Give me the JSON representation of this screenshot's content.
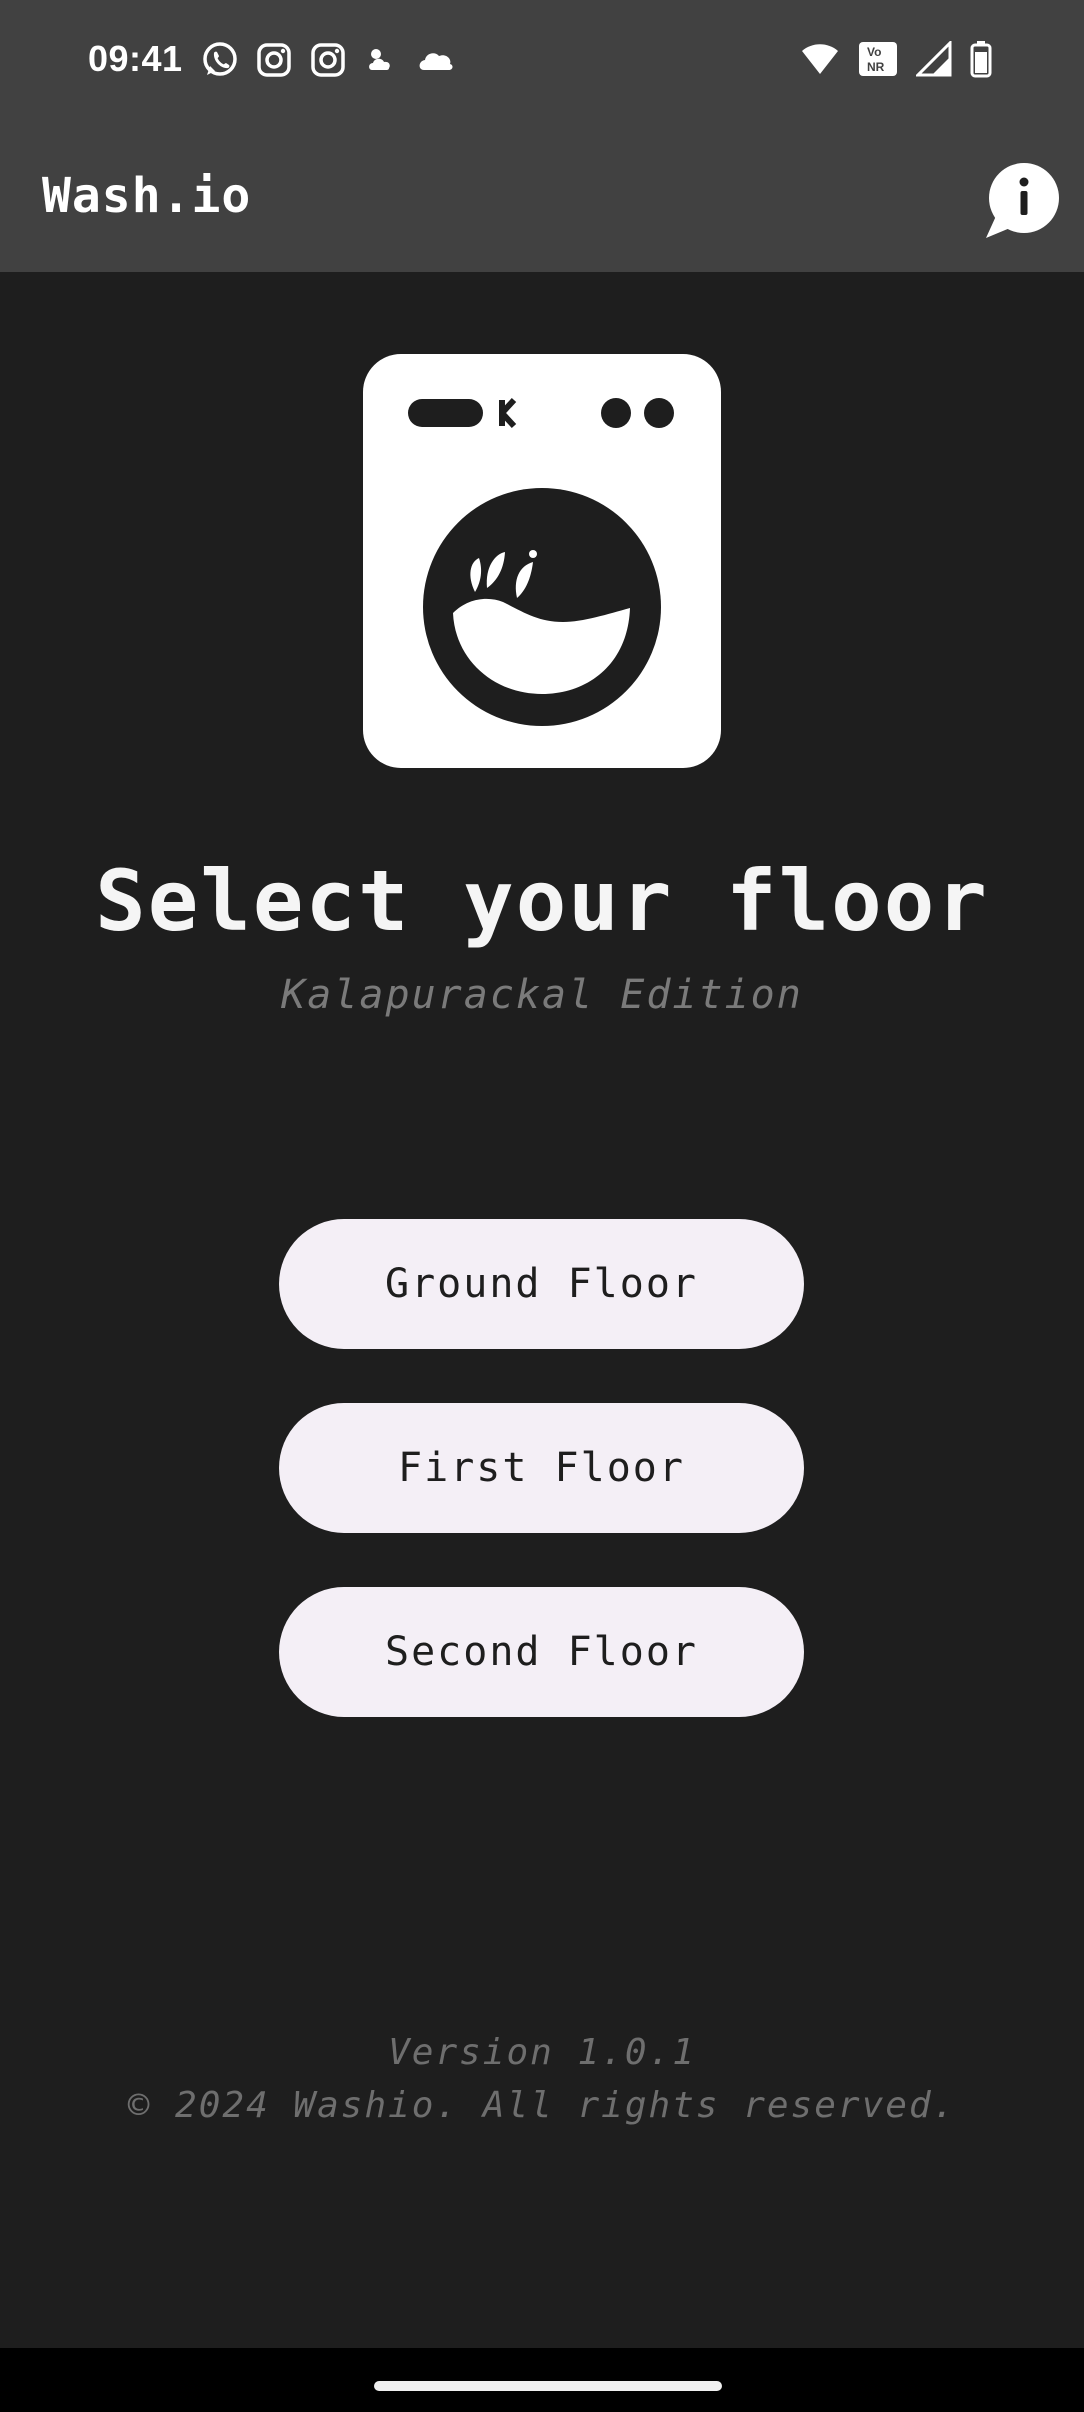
{
  "status_bar": {
    "time": "09:41",
    "notification_icons": [
      "whatsapp-icon",
      "instagram-icon",
      "instagram-icon",
      "weather-icon",
      "cloud-icon"
    ],
    "system_icons": [
      "wifi-icon",
      "vonr-icon",
      "signal-icon",
      "battery-icon"
    ],
    "vonr_label_top": "Vo",
    "vonr_label_bottom": "NR"
  },
  "app_bar": {
    "title": "Wash.io",
    "info_icon": "info-icon"
  },
  "hero": {
    "icon": "washing-machine-icon"
  },
  "main": {
    "title": "Select your floor",
    "subtitle": "Kalapurackal Edition",
    "floors": [
      {
        "label": "Ground Floor"
      },
      {
        "label": "First Floor"
      },
      {
        "label": "Second Floor"
      }
    ]
  },
  "footer": {
    "version": "Version 1.0.1",
    "copyright": "© 2024 Washio. All rights reserved."
  },
  "colors": {
    "background": "#1e1e1e",
    "app_bar": "#414141",
    "button_bg": "#f4eff6",
    "button_text": "#1e1e1e",
    "muted_text": "#7a7a7a"
  }
}
